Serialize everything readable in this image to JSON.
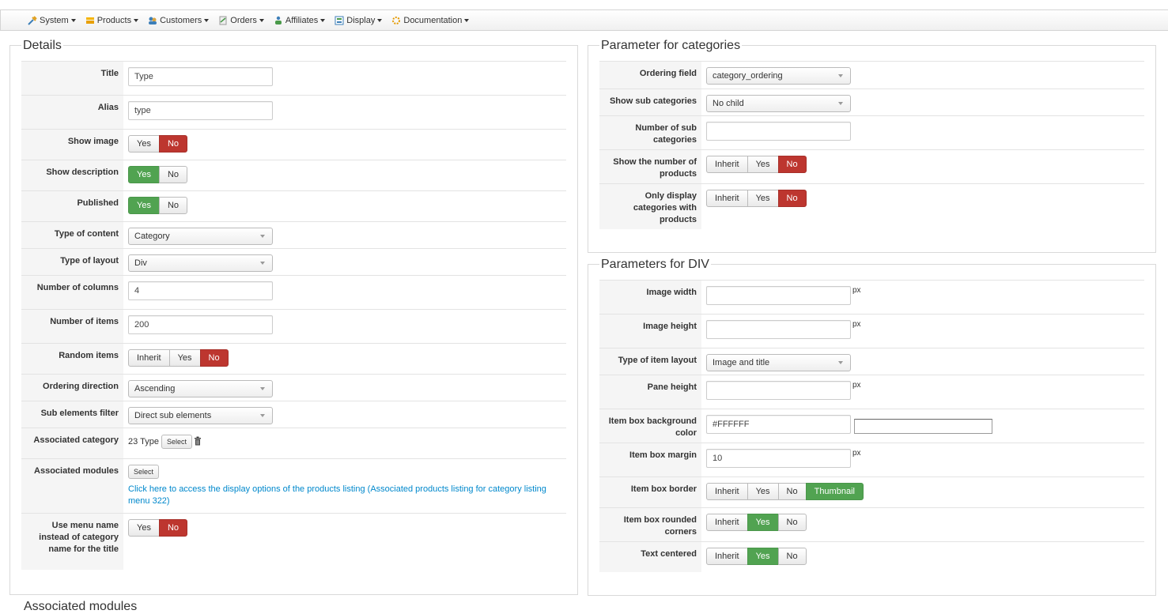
{
  "menu": [
    {
      "label": "System",
      "icon": "tools-icon"
    },
    {
      "label": "Products",
      "icon": "products-icon"
    },
    {
      "label": "Customers",
      "icon": "customers-icon"
    },
    {
      "label": "Orders",
      "icon": "orders-icon"
    },
    {
      "label": "Affiliates",
      "icon": "affiliates-icon"
    },
    {
      "label": "Display",
      "icon": "display-icon"
    },
    {
      "label": "Documentation",
      "icon": "documentation-icon"
    }
  ],
  "details": {
    "legend": "Details",
    "title": {
      "label": "Title",
      "value": "Type"
    },
    "alias": {
      "label": "Alias",
      "value": "type"
    },
    "show_image": {
      "label": "Show image",
      "yes": "Yes",
      "no": "No",
      "selected": "No"
    },
    "show_description": {
      "label": "Show description",
      "yes": "Yes",
      "no": "No",
      "selected": "Yes"
    },
    "published": {
      "label": "Published",
      "yes": "Yes",
      "no": "No",
      "selected": "Yes"
    },
    "type_of_content": {
      "label": "Type of content",
      "value": "Category"
    },
    "type_of_layout": {
      "label": "Type of layout",
      "value": "Div"
    },
    "number_of_columns": {
      "label": "Number of columns",
      "value": "4"
    },
    "number_of_items": {
      "label": "Number of items",
      "value": "200"
    },
    "random_items": {
      "label": "Random items",
      "inherit": "Inherit",
      "yes": "Yes",
      "no": "No",
      "selected": "No"
    },
    "ordering_direction": {
      "label": "Ordering direction",
      "value": "Ascending"
    },
    "sub_elements_filter": {
      "label": "Sub elements filter",
      "value": "Direct sub elements"
    },
    "associated_category": {
      "label": "Associated category",
      "value": "23 Type",
      "select": "Select"
    },
    "associated_modules": {
      "label": "Associated modules",
      "select": "Select",
      "link": "Click here to access the display options of the products listing (Associated products listing for category listing menu 322)"
    },
    "use_menu_name": {
      "label": "Use menu name instead of category name for the title",
      "yes": "Yes",
      "no": "No",
      "selected": "No"
    }
  },
  "categories": {
    "legend": "Parameter for categories",
    "ordering_field": {
      "label": "Ordering field",
      "value": "category_ordering"
    },
    "show_sub_categories": {
      "label": "Show sub categories",
      "value": "No child"
    },
    "number_of_sub_categories": {
      "label": "Number of sub categories",
      "value": ""
    },
    "show_number_of_products": {
      "label": "Show the number of products",
      "inherit": "Inherit",
      "yes": "Yes",
      "no": "No",
      "selected": "No"
    },
    "only_display_with_products": {
      "label": "Only display categories with products",
      "inherit": "Inherit",
      "yes": "Yes",
      "no": "No",
      "selected": "No"
    }
  },
  "div": {
    "legend": "Parameters for DIV",
    "unit": "px",
    "image_width": {
      "label": "Image width",
      "value": ""
    },
    "image_height": {
      "label": "Image height",
      "value": ""
    },
    "type_of_item_layout": {
      "label": "Type of item layout",
      "value": "Image and title"
    },
    "pane_height": {
      "label": "Pane height",
      "value": ""
    },
    "item_box_bg_color": {
      "label": "Item box background color",
      "value": "#FFFFFF"
    },
    "item_box_margin": {
      "label": "Item box margin",
      "value": "10"
    },
    "item_box_border": {
      "label": "Item box border",
      "inherit": "Inherit",
      "yes": "Yes",
      "no": "No",
      "thumbnail": "Thumbnail",
      "selected": "Thumbnail"
    },
    "item_box_rounded_corners": {
      "label": "Item box rounded corners",
      "inherit": "Inherit",
      "yes": "Yes",
      "no": "No",
      "selected": "Yes"
    },
    "text_centered": {
      "label": "Text centered",
      "inherit": "Inherit",
      "yes": "Yes",
      "no": "No",
      "selected": "Yes"
    }
  },
  "associated_modules_legend": "Associated modules",
  "colors": {
    "active_no": "#bd362f",
    "active_yes": "#51a351",
    "link": "#0088cc"
  }
}
